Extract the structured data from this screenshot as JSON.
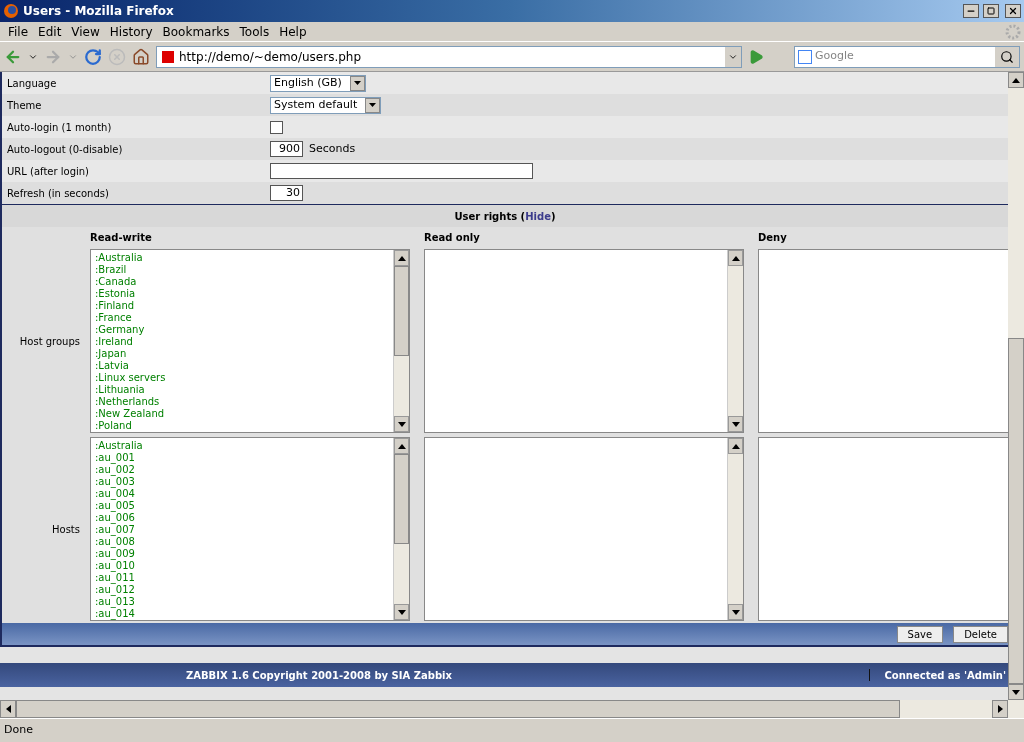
{
  "window": {
    "title": "Users - Mozilla Firefox"
  },
  "menu": [
    "File",
    "Edit",
    "View",
    "History",
    "Bookmarks",
    "Tools",
    "Help"
  ],
  "toolbar": {
    "url": "http://demo/~demo/users.php",
    "search_placeholder": "Google"
  },
  "form_rows": [
    {
      "label": "Language",
      "kind": "select",
      "value": "English (GB)"
    },
    {
      "label": "Theme",
      "kind": "select",
      "value": "System default"
    },
    {
      "label": "Auto-login (1 month)",
      "kind": "checkbox",
      "checked": false
    },
    {
      "label": "Auto-logout (0-disable)",
      "kind": "number",
      "value": "900",
      "suffix": "Seconds"
    },
    {
      "label": "URL (after login)",
      "kind": "text"
    },
    {
      "label": "Refresh (in seconds)",
      "kind": "number",
      "value": "30"
    }
  ],
  "user_rights": {
    "title": "User rights",
    "brackets": [
      "(",
      ")"
    ],
    "toggle": "Hide",
    "columns": [
      "Read-write",
      "Read only",
      "Deny"
    ],
    "rows": [
      {
        "label": "Host groups",
        "read_write": [
          ":Australia",
          ":Brazil",
          ":Canada",
          ":Estonia",
          ":Finland",
          ":France",
          ":Germany",
          ":Ireland",
          ":Japan",
          ":Latvia",
          ":Linux servers",
          ":Lithuania",
          ":Netherlands",
          ":New Zealand",
          ":Poland"
        ]
      },
      {
        "label": "Hosts",
        "read_write": [
          ":Australia",
          ":au_001",
          ":au_002",
          ":au_003",
          ":au_004",
          ":au_005",
          ":au_006",
          ":au_007",
          ":au_008",
          ":au_009",
          ":au_010",
          ":au_011",
          ":au_012",
          ":au_013",
          ":au_014"
        ]
      }
    ]
  },
  "buttons": [
    "Save",
    "Delete"
  ],
  "footer": {
    "copyright": "ZABBIX 1.6 Copyright 2001-2008 by  SIA Zabbix",
    "user": "Connected as 'Admin'"
  },
  "status_bar": "Done"
}
